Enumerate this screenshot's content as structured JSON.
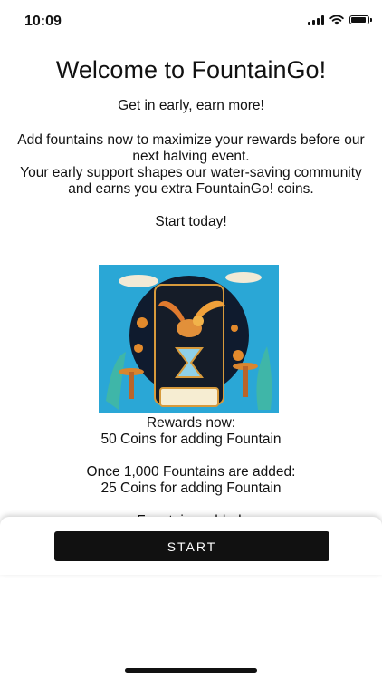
{
  "status_bar": {
    "time": "10:09",
    "battery_level": 0.9,
    "icons": [
      "signal-icon",
      "wifi-icon",
      "battery-icon"
    ]
  },
  "welcome": {
    "title": "Welcome to FountainGo!",
    "tagline": "Get in early, earn more!",
    "intro_line_1": "Add fountains now to maximize your rewards before our next halving event.",
    "intro_line_2": "Your early support shapes our water-saving community and earns you extra FountainGo! coins.",
    "cta": "Start today!"
  },
  "rewards": {
    "now_label": "Rewards now:",
    "now_value": "50 Coins for adding Fountain",
    "later_label": "Once 1,000 Fountains are added:",
    "later_value": "25 Coins for adding Fountain",
    "partial_text": "Fountains added:"
  },
  "actions": {
    "start_label": "START"
  },
  "colors": {
    "primary": "#111111",
    "background": "#ffffff",
    "hero_sky": "#2aa7d6",
    "hero_orange": "#e07a2e"
  }
}
